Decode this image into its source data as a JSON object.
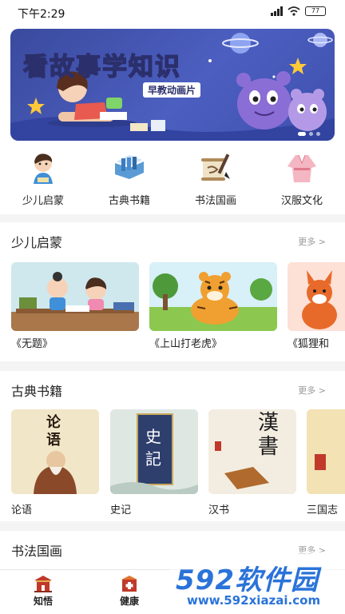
{
  "status": {
    "time": "下午2:29",
    "battery": "77"
  },
  "banner": {
    "title": "看故事学知识",
    "subtitle": "早教动画片"
  },
  "categories": [
    {
      "label": "少儿启蒙",
      "icon": "child-icon"
    },
    {
      "label": "古典书籍",
      "icon": "books-icon"
    },
    {
      "label": "书法国画",
      "icon": "scroll-brush-icon"
    },
    {
      "label": "汉服文化",
      "icon": "hanfu-icon"
    }
  ],
  "sections": [
    {
      "title": "少儿启蒙",
      "more": "更多 >",
      "items": [
        "《无题》",
        "《上山打老虎》",
        "《狐狸和"
      ]
    },
    {
      "title": "古典书籍",
      "more": "更多 >",
      "items": [
        "论语",
        "史记",
        "汉书",
        "三国志"
      ],
      "cover_text": [
        "论语",
        "史記",
        "漢書"
      ]
    },
    {
      "title": "书法国画",
      "more": "更多 >"
    }
  ],
  "tabs": [
    {
      "label": "知悟",
      "icon": "temple-icon"
    },
    {
      "label": "健康",
      "icon": "pharmacy-icon"
    }
  ],
  "watermark": {
    "brand": "592软件园",
    "url": "www.592xiazai.com"
  },
  "colors": {
    "accent": "#c0392b",
    "banner_bg": "#4c5fc0",
    "watermark": "#2a73d9"
  }
}
